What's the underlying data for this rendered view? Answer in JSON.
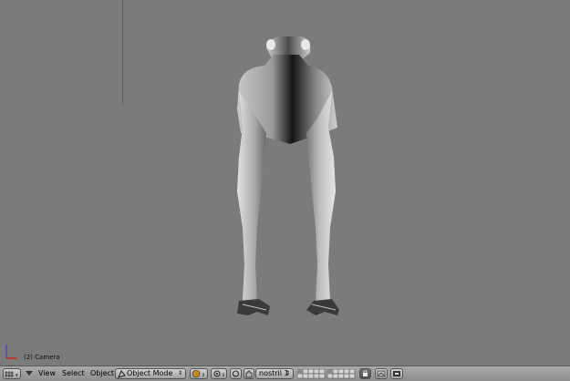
{
  "viewport": {
    "view_label": "(2) Camera"
  },
  "header": {
    "menus": {
      "view": "View",
      "select": "Select",
      "object": "Object"
    },
    "mode": "Object Mode",
    "layer_field": "nostril 1"
  },
  "icons": {
    "editor_type": "grid-icon",
    "collapse": "triangle-down-icon",
    "mode": "object-mode-icon",
    "draw_type": "shading-sphere-icon",
    "pivot": "pivot-icon",
    "manipulator": "hand-icon",
    "layers": "layer-buttons",
    "lock": "lock-icon",
    "render_preview": "render-icon",
    "camera_view": "camera-icon"
  },
  "colors": {
    "viewport_bg": "#7b7b7b",
    "header_bg": "#9a9a9a"
  }
}
